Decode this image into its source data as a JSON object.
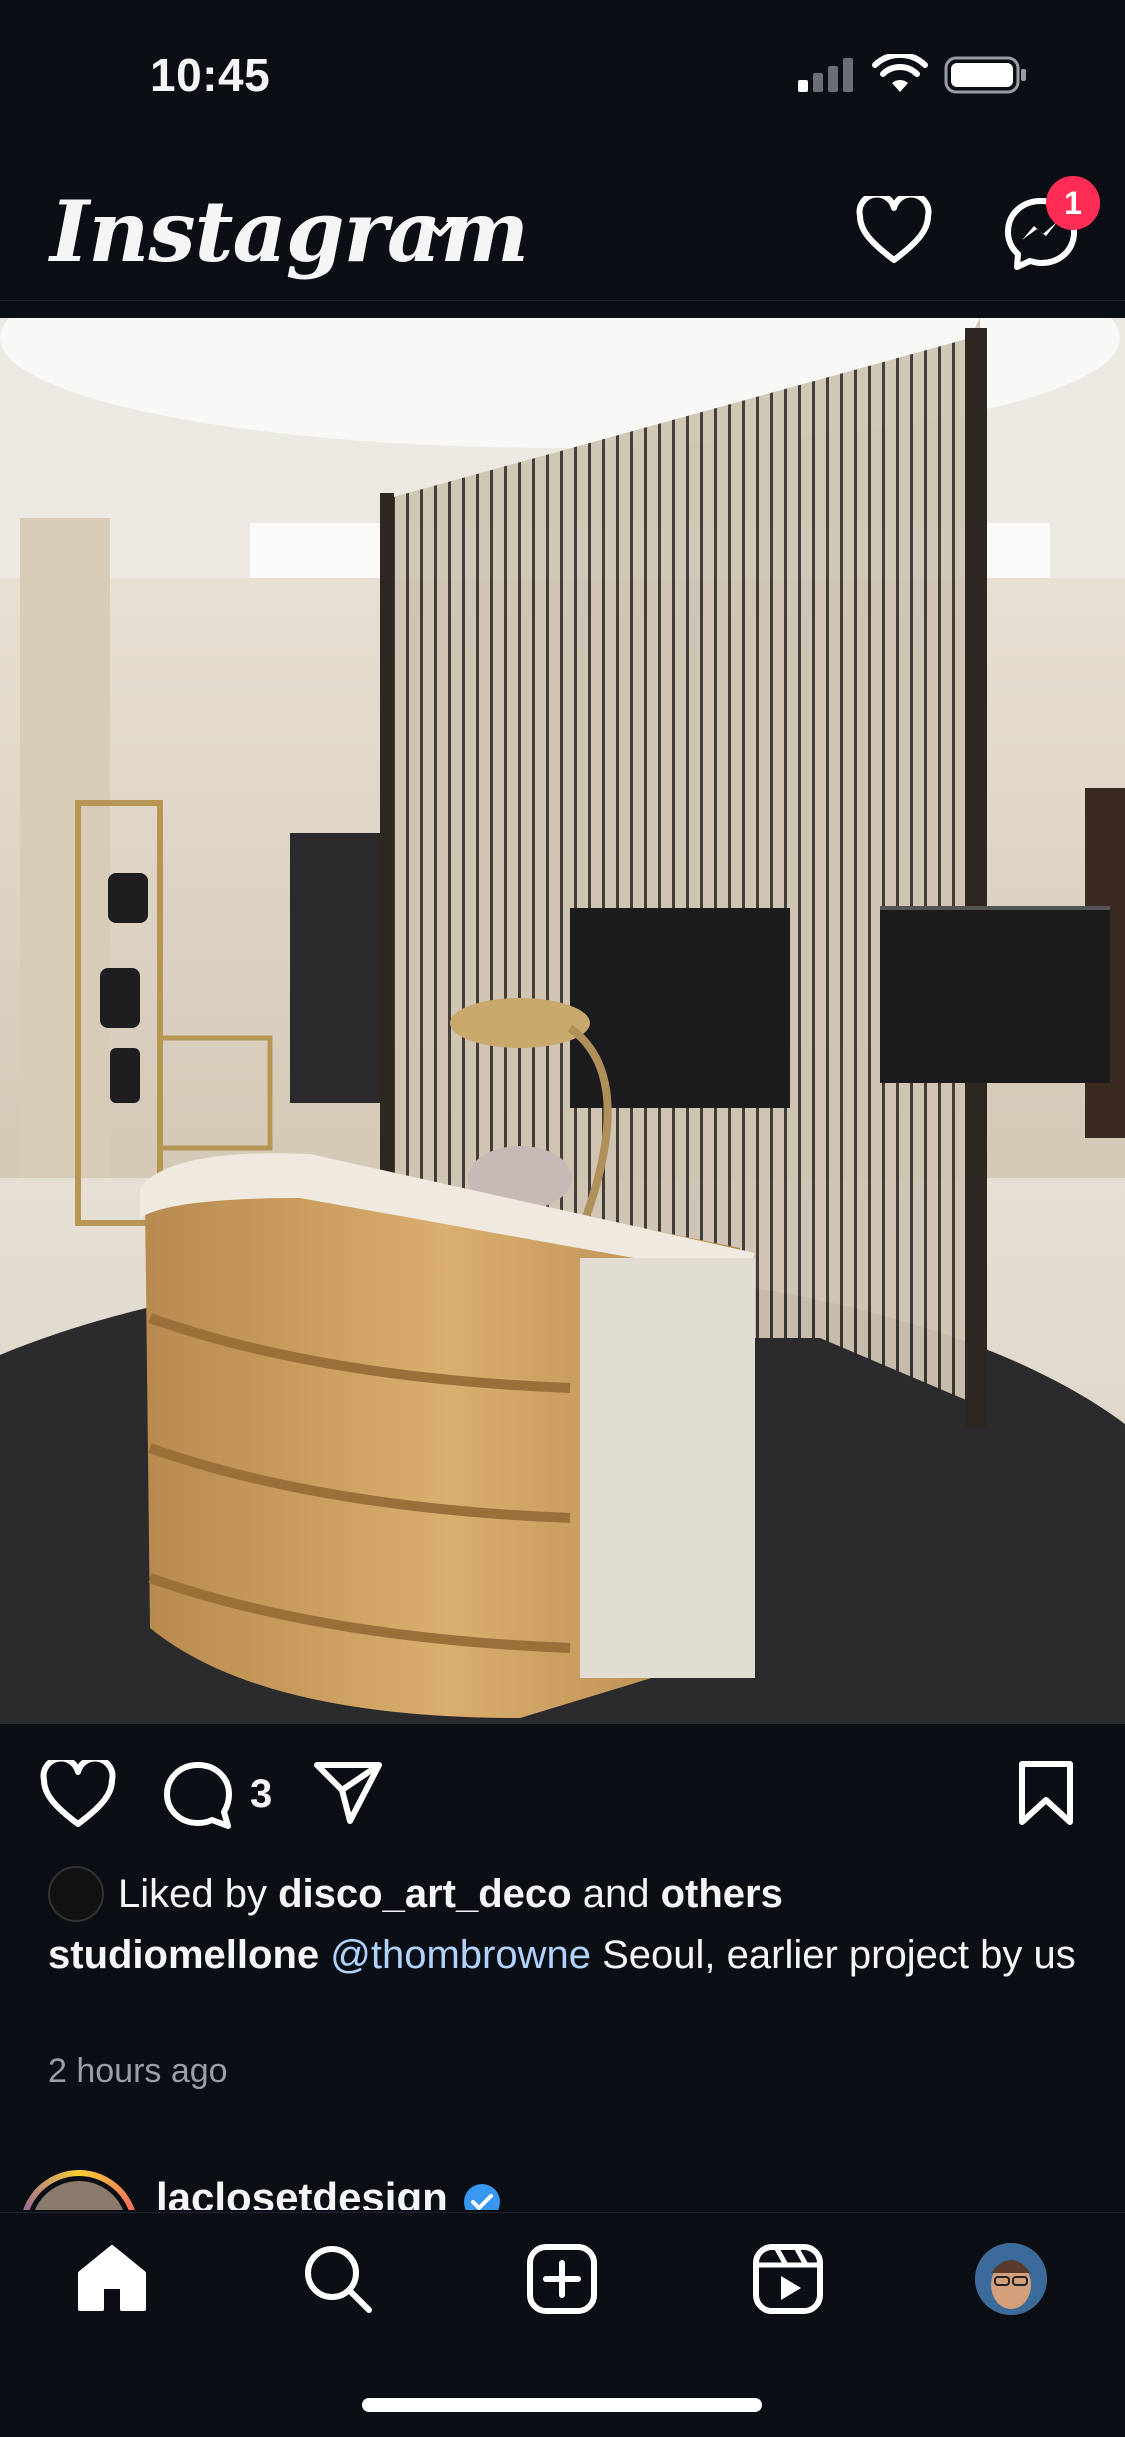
{
  "status_bar": {
    "time": "10:45"
  },
  "header": {
    "logo": "Instagram",
    "notification_count": "1"
  },
  "post": {
    "comment_count": "3",
    "liked_by_prefix": "Liked by",
    "liked_by_user": "disco_art_deco",
    "liked_by_and": "and",
    "liked_by_others": "others",
    "caption_user": "studiomellone",
    "caption_mention": "@thombrowne",
    "caption_text": "Seoul, earlier project by us",
    "time_ago": "2 hours ago"
  },
  "next_post": {
    "username": "laclosetdesign"
  },
  "nav": {
    "items": [
      "home-icon",
      "search-icon",
      "create-icon",
      "reels-icon",
      "profile-avatar"
    ]
  },
  "colors": {
    "background": "#0b0e14",
    "badge": "#ff2d55",
    "mention": "#b0d3ff",
    "verified": "#3897f0"
  }
}
